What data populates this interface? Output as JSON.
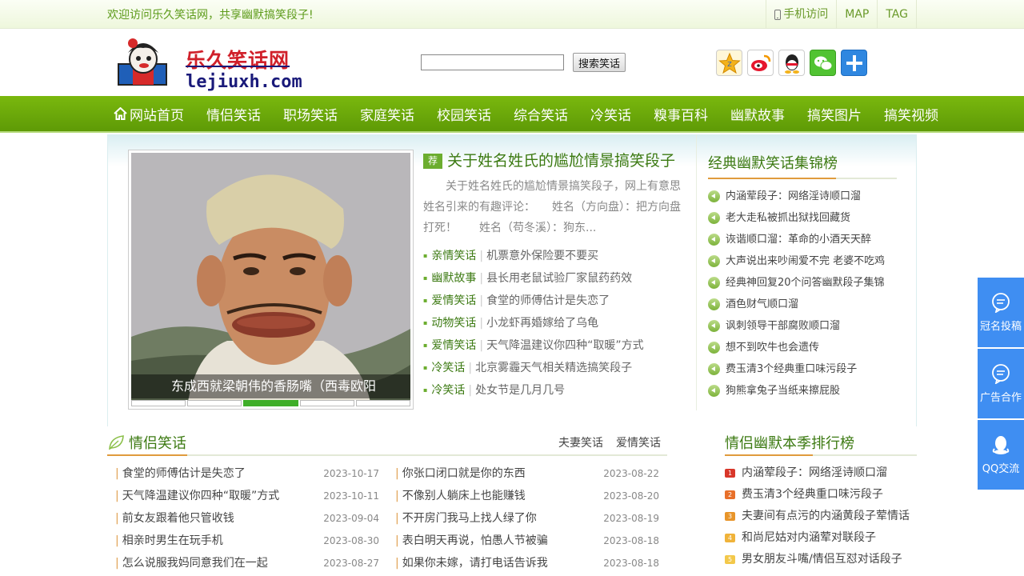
{
  "topbar": {
    "welcome": "欢迎访问乐久笑话网，共享幽默搞笑段子!",
    "links": [
      "手机访问",
      "MAP",
      "TAG"
    ]
  },
  "header": {
    "logo_cn": "乐久笑话网",
    "logo_en": "lejiuxh.com",
    "search_placeholder": "",
    "search_button": "搜索笑话"
  },
  "share_icons": [
    "qzone-icon",
    "weibo-icon",
    "qq-icon",
    "wechat-icon",
    "more-share-icon"
  ],
  "nav": [
    "网站首页",
    "情侣笑话",
    "职场笑话",
    "家庭笑话",
    "校园笑话",
    "综合笑话",
    "冷笑话",
    "糗事百科",
    "幽默故事",
    "搞笑图片",
    "搞笑视频"
  ],
  "slider": {
    "caption": "东成西就梁朝伟的香肠嘴（西毒欧阳"
  },
  "headline": {
    "tag": "荐",
    "title": "关于姓名姓氏的尴尬情景搞笑段子",
    "summary": "关于姓名姓氏的尴尬情景搞笑段子，网上有意思姓名引来的有趣评论：　　姓名（方向盘）：把方向盘打死！　　姓名（苟冬溪）：狗东...",
    "items": [
      {
        "cat": "亲情笑话",
        "text": "机票意外保险要不要买"
      },
      {
        "cat": "幽默故事",
        "text": "县长用老鼠试验厂家鼠药药效"
      },
      {
        "cat": "爱情笑话",
        "text": "食堂的师傅估计是失恋了"
      },
      {
        "cat": "动物笑话",
        "text": "小龙虾再婚嫁给了乌龟"
      },
      {
        "cat": "爱情笑话",
        "text": "天气降温建议你四种“取暖”方式"
      },
      {
        "cat": "冷笑话",
        "text": "北京雾霾天气相关精选搞笑段子"
      },
      {
        "cat": "冷笑话",
        "text": "处女节是几月几号"
      }
    ]
  },
  "classic_rank": {
    "title": "经典幽默笑话集锦榜",
    "items": [
      "内涵荤段子：网络淫诗顺口溜",
      "老大走私被抓出狱找回藏货",
      "诙谐顺口溜：革命的小酒天天醉",
      "大声说出来吵闹爱不完 老婆不吃鸡",
      "经典神回复20个问答幽默段子集锦",
      "酒色财气顺口溜",
      "讽刺领导干部腐败顺口溜",
      "想不到吹牛也会遗传",
      "费玉清3个经典重口味污段子",
      "狗熊拿兔子当纸来擦屁股"
    ]
  },
  "couple_section": {
    "title": "情侣笑话",
    "links": [
      "夫妻笑话",
      "爱情笑话"
    ],
    "left": [
      {
        "title": "食堂的师傅估计是失恋了",
        "date": "2023-10-17"
      },
      {
        "title": "天气降温建议你四种“取暖”方式",
        "date": "2023-10-11"
      },
      {
        "title": "前女友跟着他只管收钱",
        "date": "2023-09-04"
      },
      {
        "title": "相亲时男生在玩手机",
        "date": "2023-08-30"
      },
      {
        "title": "怎么说服我妈同意我们在一起",
        "date": "2023-08-27"
      }
    ],
    "right": [
      {
        "title": "你张口闭口就是你的东西",
        "date": "2023-08-22"
      },
      {
        "title": "不像别人躺床上也能赚钱",
        "date": "2023-08-20"
      },
      {
        "title": "不开房门我马上找人绿了你",
        "date": "2023-08-19"
      },
      {
        "title": "表白明天再说，怕愚人节被骗",
        "date": "2023-08-18"
      },
      {
        "title": "如果你未嫁，请打电话告诉我",
        "date": "2023-08-18"
      }
    ]
  },
  "season_rank": {
    "title": "情侣幽默本季排行榜",
    "items": [
      {
        "n": "1",
        "text": "内涵荤段子：网络淫诗顺口溜",
        "color": "#d8372a"
      },
      {
        "n": "2",
        "text": "费玉清3个经典重口味污段子",
        "color": "#e8702a"
      },
      {
        "n": "3",
        "text": "夫妻间有点污的内涵黄段子荤情话",
        "color": "#e8952a"
      },
      {
        "n": "4",
        "text": "和尚尼姑对内涵荤对联段子",
        "color": "#f0b33a"
      },
      {
        "n": "5",
        "text": "男女朋友斗嘴/情侣互怼对话段子",
        "color": "#f3c84a"
      }
    ]
  },
  "side_float": [
    "冠名投稿",
    "广告合作",
    "QQ交流"
  ],
  "colors": {
    "nav_green": "#6aaa0a",
    "accent_orange": "#e09b3d",
    "float_blue": "#3f8ef2"
  }
}
